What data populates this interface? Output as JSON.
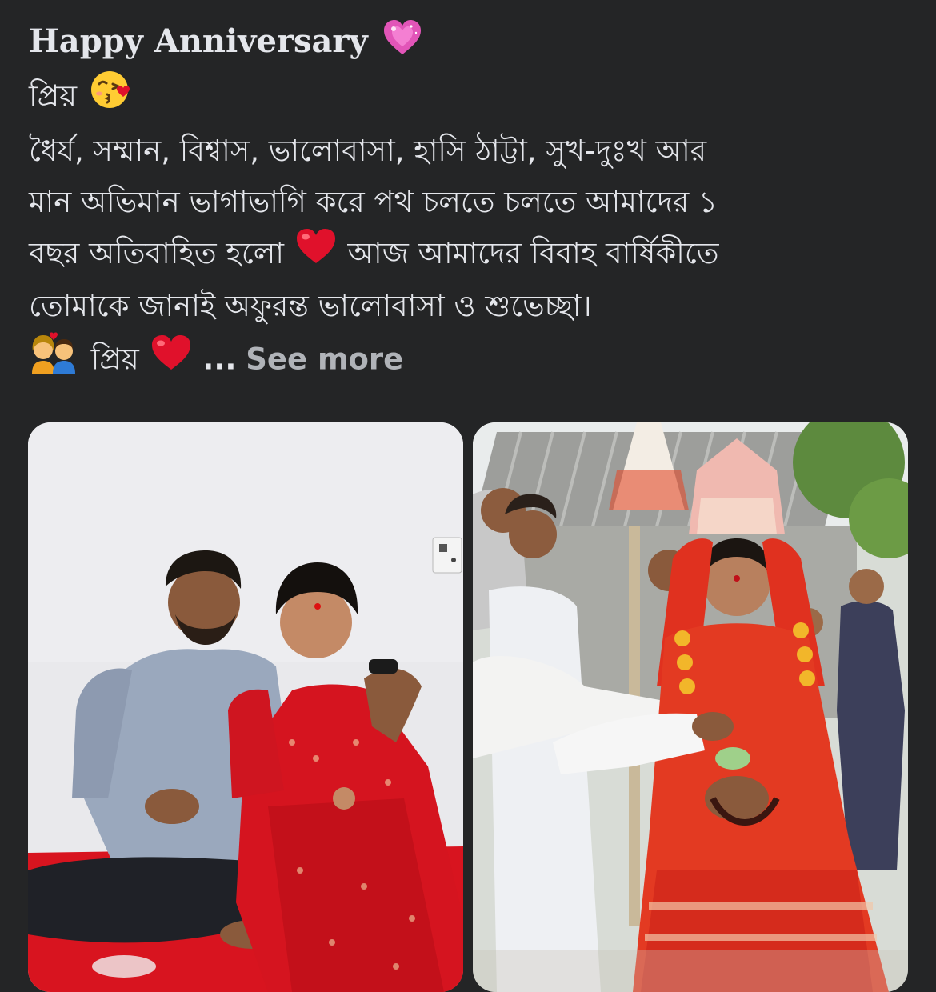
{
  "post": {
    "lines": [
      {
        "text": "Happy Anniversary",
        "emoji": "purple-heart-icon"
      },
      {
        "text": "প্রিয়",
        "emoji": "kissing-face-icon"
      },
      {
        "text": "ধৈর্য, সম্মান, বিশ্বাস, ভালোবাসা, হাসি ঠাট্টা, সুখ-দুঃখ আর"
      },
      {
        "text": "মান অভিমান ভাগাভাগি করে পথ চলতে চলতে আমাদের ১"
      },
      {
        "text_before": "বছর অতিবাহিত হলো",
        "emoji": "red-heart-icon",
        "text_after": "আজ আমাদের বিবাহ বার্ষিকীতে"
      },
      {
        "text": "তোমাকে জানাই অফুরন্ত ভালোবাসা ও শুভেচ্ছা।"
      },
      {
        "emoji_lead": "couple-icon",
        "text": "প্রিয়",
        "emoji": "red-heart-icon",
        "ellipsis": "...",
        "see_more": "See more"
      }
    ]
  },
  "colors": {
    "background": "#242526",
    "text": "#e4e6eb",
    "see_more": "#b0b3b8",
    "heart_red": "#e0112b",
    "heart_pink": "#e255b8"
  },
  "photos": [
    {
      "name": "anniversary-couple-photo"
    },
    {
      "name": "wedding-ceremony-photo"
    }
  ]
}
